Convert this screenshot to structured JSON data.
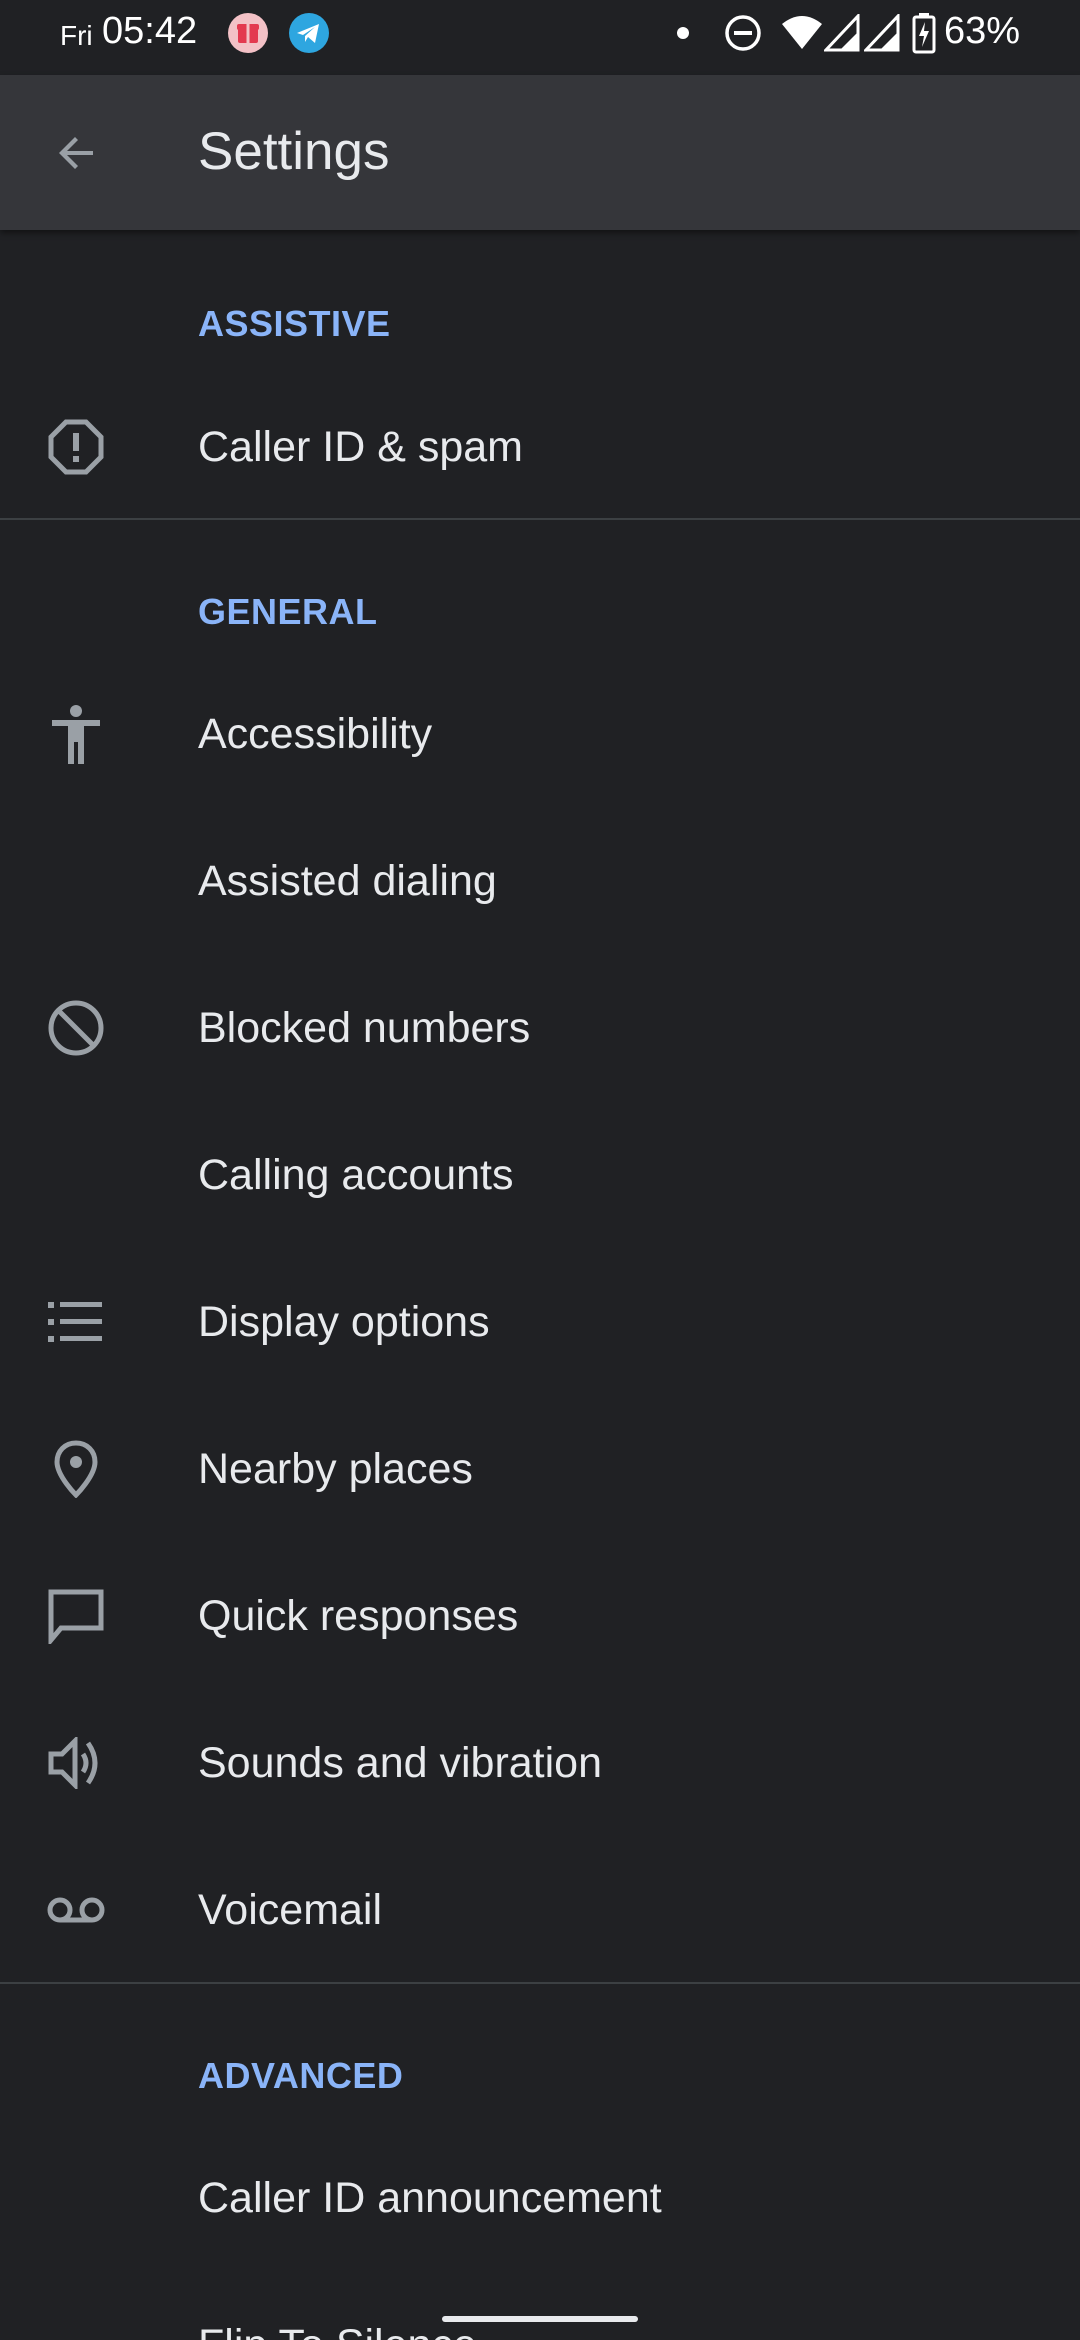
{
  "status_bar": {
    "day": "Fri",
    "time": "05:42",
    "battery_percent": "63%",
    "icons": [
      "gift-app-icon",
      "telegram-icon",
      "notification-dot-icon",
      "do-not-disturb-icon",
      "wifi-icon",
      "signal-icon",
      "signal-icon",
      "battery-charging-icon"
    ]
  },
  "app_bar": {
    "back_icon": "arrow-back-icon",
    "title": "Settings"
  },
  "sections": {
    "assistive": {
      "header": "ASSISTIVE",
      "items": [
        {
          "label": "Caller ID & spam",
          "icon": "spam-shield-icon"
        }
      ]
    },
    "general": {
      "header": "GENERAL",
      "items": [
        {
          "label": "Accessibility",
          "icon": "accessibility-icon"
        },
        {
          "label": "Assisted dialing",
          "icon": ""
        },
        {
          "label": "Blocked numbers",
          "icon": "block-icon"
        },
        {
          "label": "Calling accounts",
          "icon": ""
        },
        {
          "label": "Display options",
          "icon": "list-icon"
        },
        {
          "label": "Nearby places",
          "icon": "location-pin-icon"
        },
        {
          "label": "Quick responses",
          "icon": "chat-bubble-icon"
        },
        {
          "label": "Sounds and vibration",
          "icon": "volume-icon"
        },
        {
          "label": "Voicemail",
          "icon": "voicemail-icon"
        }
      ]
    },
    "advanced": {
      "header": "ADVANCED",
      "items": [
        {
          "label": "Caller ID announcement",
          "icon": ""
        },
        {
          "label": "Flip To Silence",
          "icon": ""
        }
      ]
    }
  },
  "colors": {
    "background": "#202124",
    "app_bar": "#35363a",
    "accent": "#8ab4f8",
    "text": "#e8eaed",
    "icon": "#9aa0a6"
  }
}
